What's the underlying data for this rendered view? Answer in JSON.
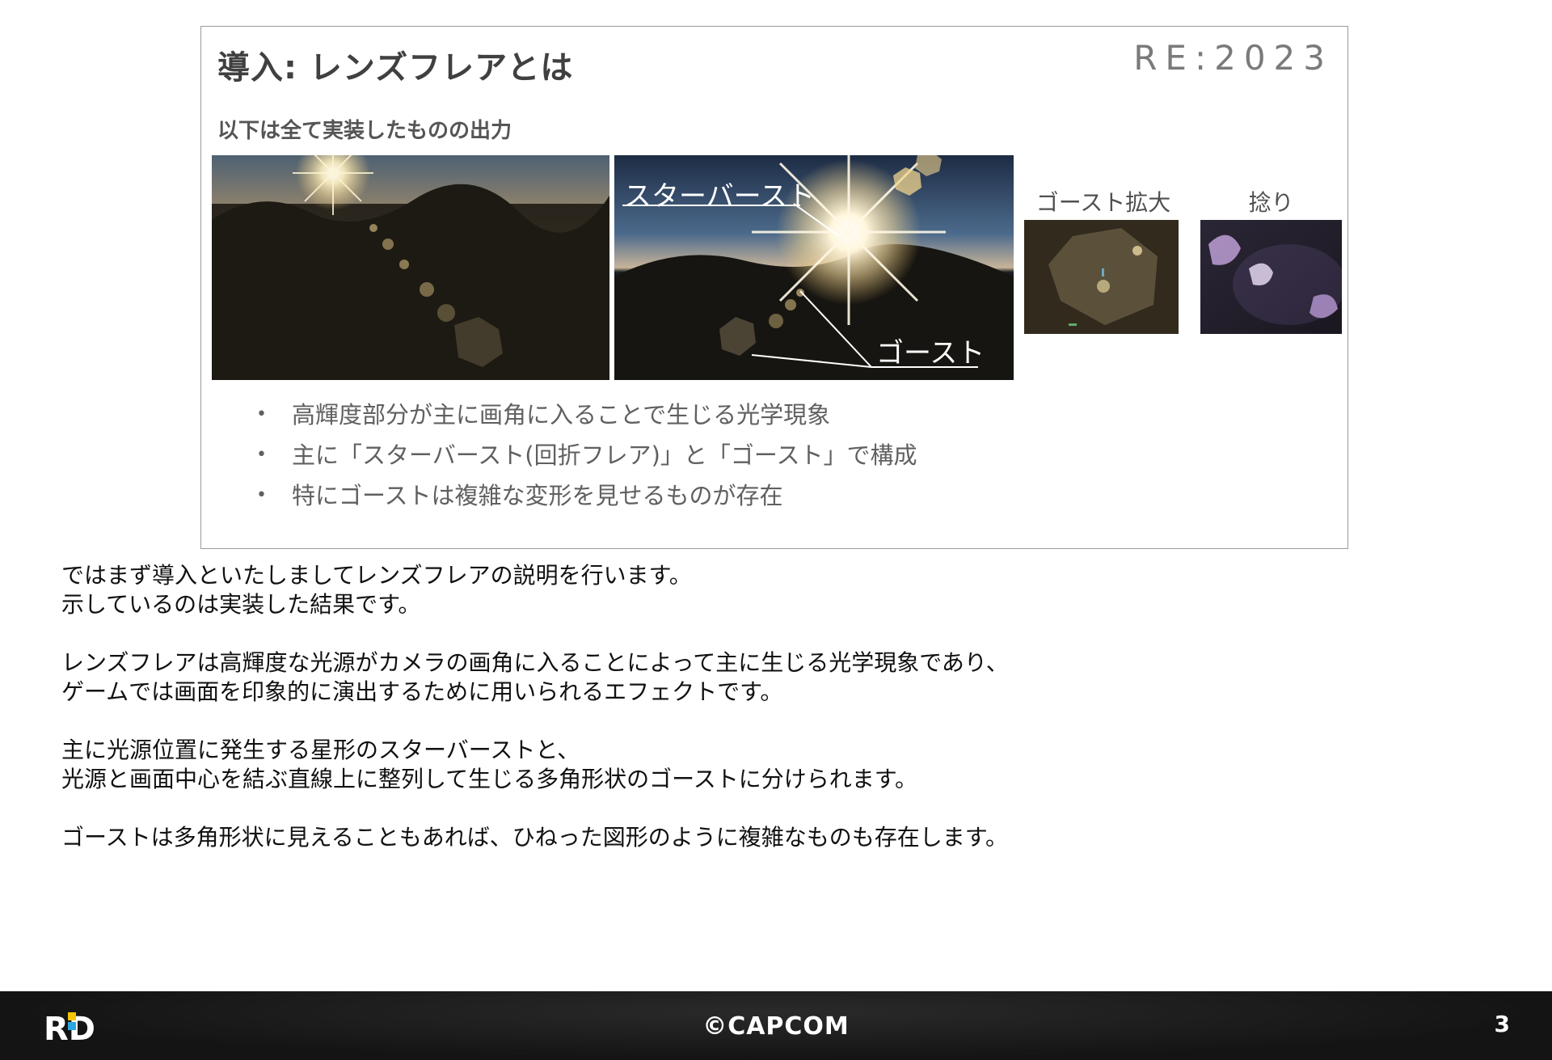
{
  "slide": {
    "title": "導入: レンズフレアとは",
    "event_logo": "RE:2023",
    "subtitle": "以下は全て実装したものの出力",
    "overlay_starburst": "スターバースト",
    "overlay_ghost": "ゴースト",
    "label_ghost_zoom": "ゴースト拡大",
    "label_twist": "捻り",
    "bullets": [
      "高輝度部分が主に画角に入ることで生じる光学現象",
      "主に「スターバースト(回折フレア)」と「ゴースト」で構成",
      "特にゴーストは複雑な変形を見せるものが存在"
    ]
  },
  "notes": {
    "p1": [
      "ではまず導入といたしましてレンズフレアの説明を行います。",
      "示しているのは実装した結果です。"
    ],
    "p2": [
      "レンズフレアは高輝度な光源がカメラの画角に入ることによって主に生じる光学現象であり、",
      "ゲームでは画面を印象的に演出するために用いられるエフェクトです。"
    ],
    "p3": [
      "主に光源位置に発生する星形のスターバーストと、",
      "光源と画面中心を結ぶ直線上に整列して生じる多角形状のゴーストに分けられます。"
    ],
    "p4": [
      "ゴーストは多角形状に見えることもあれば、ひねった図形のように複雑なものも存在します。"
    ]
  },
  "footer": {
    "logo": "RD",
    "copyright": "©CAPCOM",
    "page": "3"
  },
  "icons": {
    "logo": "rd-logo",
    "bullet": "bullet-dot-icon"
  }
}
